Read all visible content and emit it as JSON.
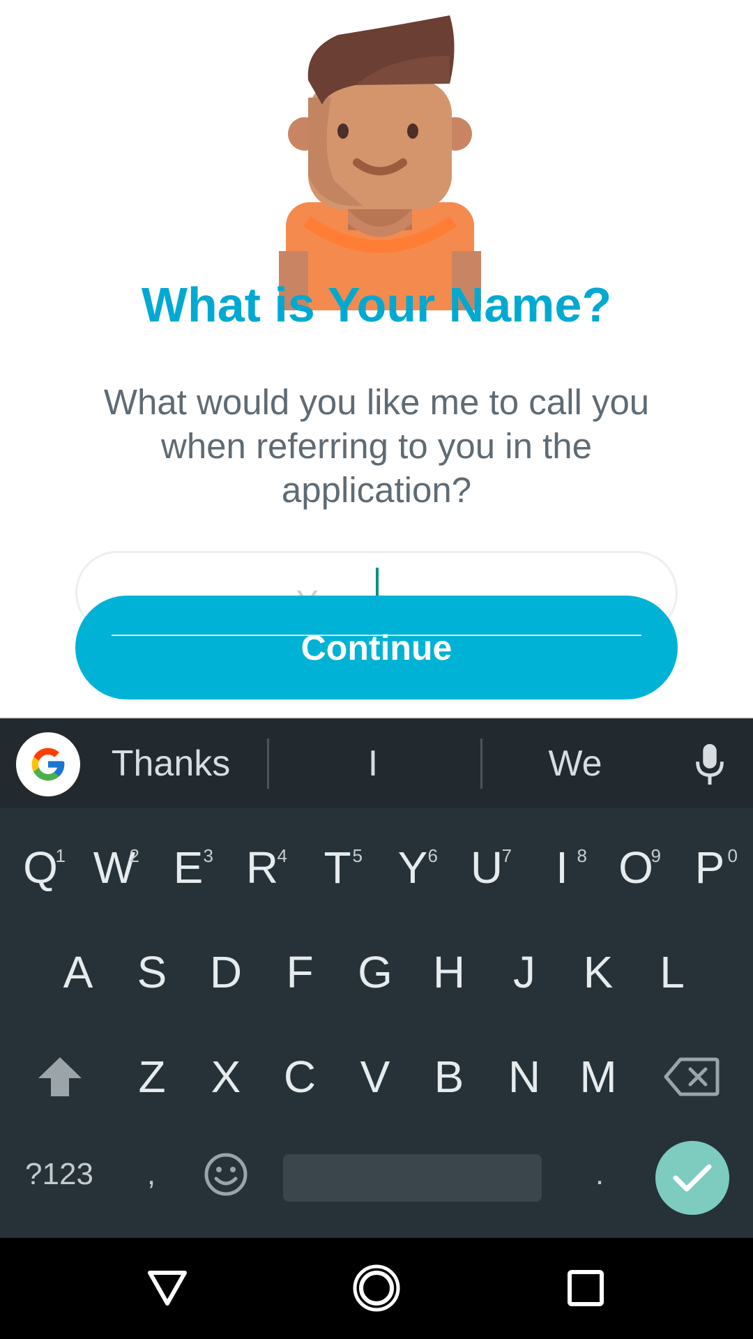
{
  "screen": {
    "title": "What is Your Name?",
    "subtitle": "What would you like me to call you when referring to you in the application?",
    "name_input": {
      "placeholder": "Your name",
      "value": ""
    },
    "continue_label": "Continue"
  },
  "suggestions": {
    "items": [
      "Thanks",
      "I",
      "We"
    ]
  },
  "keyboard": {
    "row1": [
      {
        "key": "Q",
        "hint": "1"
      },
      {
        "key": "W",
        "hint": "2"
      },
      {
        "key": "E",
        "hint": "3"
      },
      {
        "key": "R",
        "hint": "4"
      },
      {
        "key": "T",
        "hint": "5"
      },
      {
        "key": "Y",
        "hint": "6"
      },
      {
        "key": "U",
        "hint": "7"
      },
      {
        "key": "I",
        "hint": "8"
      },
      {
        "key": "O",
        "hint": "9"
      },
      {
        "key": "P",
        "hint": "0"
      }
    ],
    "row2": [
      "A",
      "S",
      "D",
      "F",
      "G",
      "H",
      "J",
      "K",
      "L"
    ],
    "row3": [
      "Z",
      "X",
      "C",
      "V",
      "B",
      "N",
      "M"
    ],
    "row4": {
      "symbols": "?123",
      "comma": ",",
      "period": "."
    }
  },
  "colors": {
    "accent": "#00b2d6",
    "title": "#00a9d2",
    "keyboard_bg": "#263238",
    "enter_key": "#7ecbc0"
  },
  "icons": [
    "avatar-illustration",
    "google-g-icon",
    "mic-icon",
    "shift-icon",
    "backspace-icon",
    "emoji-icon",
    "check-icon",
    "nav-back-icon",
    "nav-home-icon",
    "nav-recents-icon"
  ]
}
